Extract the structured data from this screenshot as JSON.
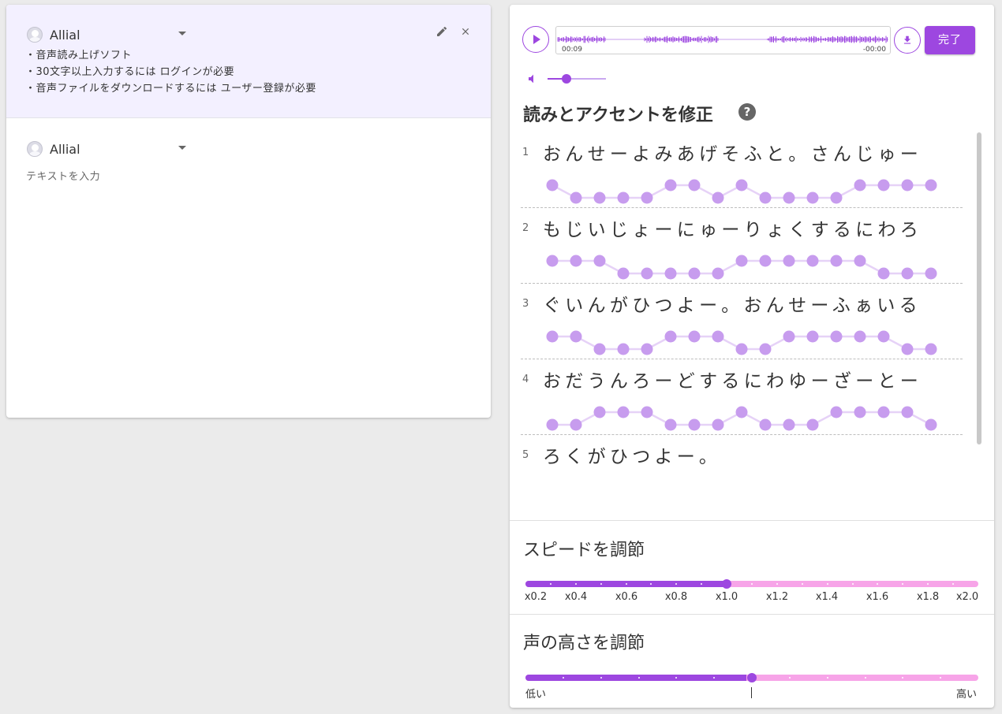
{
  "editor": {
    "blocks": [
      {
        "speaker": "Allial",
        "lines": [
          "・音声読み上げソフト",
          "・30文字以上入力するには ログインが必要",
          "・音声ファイルをダウンロードするには ユーザー登録が必要"
        ]
      },
      {
        "speaker": "Allial",
        "placeholder": "テキストを入力"
      }
    ]
  },
  "player": {
    "time_elapsed": "00:09",
    "time_remaining": "-00:00",
    "done_label": "完了",
    "volume": 0.33
  },
  "accent": {
    "title": "読みとアクセントを修正",
    "rows": [
      {
        "num": "1",
        "text": "おんせーよみあげそふと。さんじゅー",
        "pitch": [
          1,
          0,
          0,
          0,
          0,
          1,
          1,
          0,
          1,
          0,
          0,
          0,
          0,
          1,
          1,
          1,
          1
        ]
      },
      {
        "num": "2",
        "text": "もじいじょーにゅーりょくするにわろ",
        "pitch": [
          1,
          1,
          1,
          0,
          0,
          0,
          0,
          0,
          1,
          1,
          1,
          1,
          1,
          1,
          0,
          0,
          0
        ]
      },
      {
        "num": "3",
        "text": "ぐいんがひつよー。おんせーふぁいる",
        "pitch": [
          1,
          1,
          0,
          0,
          0,
          1,
          1,
          1,
          0,
          0,
          1,
          1,
          1,
          1,
          1,
          0,
          0
        ]
      },
      {
        "num": "4",
        "text": "おだうんろーどするにわゆーざーとー",
        "pitch": [
          0,
          0,
          1,
          1,
          1,
          0,
          0,
          0,
          1,
          0,
          0,
          0,
          1,
          1,
          1,
          1,
          0
        ]
      },
      {
        "num": "5",
        "text": "ろくがひつよー。",
        "pitch": []
      }
    ]
  },
  "speed": {
    "title": "スピードを調節",
    "value": 1.0,
    "min": 0.2,
    "max": 2.0,
    "labels": [
      "x0.2",
      "x0.4",
      "x0.6",
      "x0.8",
      "x1.0",
      "x1.2",
      "x1.4",
      "x1.6",
      "x1.8",
      "x2.0"
    ]
  },
  "pitch": {
    "title": "声の高さを調節",
    "value": 0.5,
    "low_label": "低い",
    "high_label": "高い"
  },
  "colors": {
    "accent": "#9d47e0",
    "slider_remaining": "#f7a4e8",
    "pitch_dot": "#c79cee",
    "pitch_line": "#e6d2f7"
  }
}
